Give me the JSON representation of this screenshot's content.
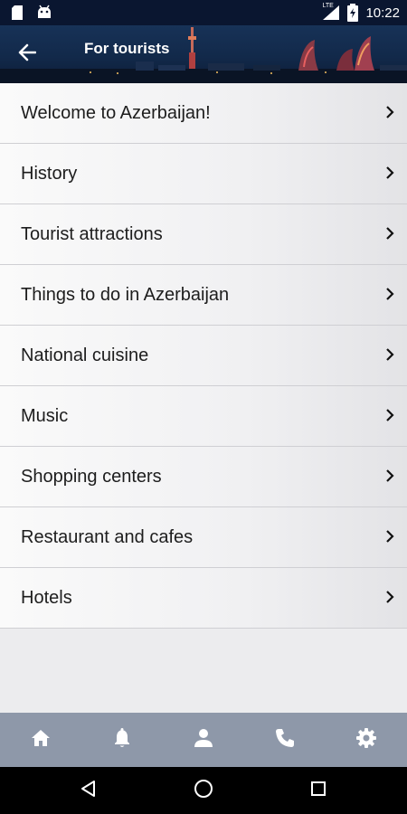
{
  "status_bar": {
    "time": "10:22",
    "network": "LTE",
    "icons": [
      "sd-card-icon",
      "android-icon",
      "signal-icon",
      "battery-icon"
    ]
  },
  "header": {
    "title": "For tourists",
    "back_icon": "arrow-left-icon"
  },
  "menu": {
    "items": [
      {
        "label": "Welcome to Azerbaijan!"
      },
      {
        "label": "History"
      },
      {
        "label": "Tourist attractions"
      },
      {
        "label": "Things to do in Azerbaijan"
      },
      {
        "label": "National cuisine"
      },
      {
        "label": "Music"
      },
      {
        "label": "Shopping centers"
      },
      {
        "label": "Restaurant and cafes"
      },
      {
        "label": "Hotels"
      }
    ],
    "chevron_icon": "chevron-right-icon"
  },
  "tab_bar": {
    "icons": [
      "home-icon",
      "bell-icon",
      "person-icon",
      "phone-icon",
      "gear-icon"
    ],
    "color": "#ffffff",
    "background": "#8e98a9"
  },
  "nav_bar": {
    "icons": [
      "back-triangle-icon",
      "home-circle-icon",
      "recents-square-icon"
    ]
  }
}
